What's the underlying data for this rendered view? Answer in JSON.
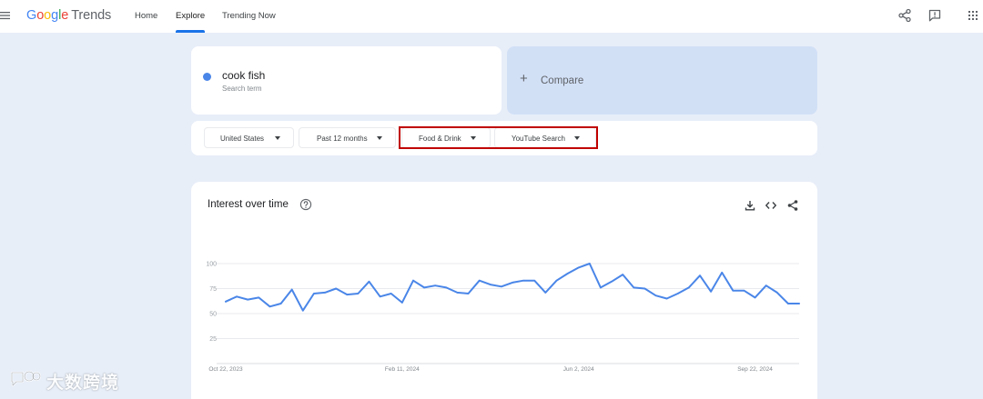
{
  "header": {
    "logo": {
      "google": [
        "G",
        "o",
        "o",
        "g",
        "l",
        "e"
      ],
      "product": "Trends"
    },
    "nav": [
      {
        "label": "Home"
      },
      {
        "label": "Explore"
      },
      {
        "label": "Trending Now"
      }
    ],
    "active_nav": "Explore",
    "icons": [
      "menu-icon",
      "share-icon",
      "feedback-icon",
      "apps-grid-icon"
    ]
  },
  "search": {
    "term": "cook fish",
    "term_subtitle": "Search term",
    "term_color": "#4a86e8",
    "compare_label": "Compare",
    "compare_icon": "plus-icon"
  },
  "filters": {
    "region": "United States",
    "time_range": "Past 12 months",
    "category": "Food & Drink",
    "property": "YouTube Search",
    "highlight_color": "#c00000"
  },
  "chart": {
    "title": "Interest over time",
    "icons": [
      "help-icon",
      "download-icon",
      "embed-icon",
      "share-icon"
    ]
  },
  "chart_data": {
    "type": "line",
    "title": "Interest over time",
    "xlabel": "",
    "ylabel": "",
    "ylim": [
      0,
      100
    ],
    "y_ticks": [
      25,
      50,
      75,
      100
    ],
    "x_tick_labels": [
      "Oct 22, 2023",
      "Feb 11, 2024",
      "Jun 2, 2024",
      "Sep 22, 2024"
    ],
    "x_tick_indices": [
      0,
      16,
      32,
      48
    ],
    "grid": true,
    "series": [
      {
        "color": "#4a86e8",
        "values": [
          62,
          67,
          64,
          66,
          57,
          60,
          74,
          53,
          70,
          71,
          75,
          69,
          70,
          82,
          67,
          70,
          61,
          83,
          76,
          78,
          76,
          71,
          70,
          83,
          79,
          77,
          81,
          83,
          83,
          71,
          83,
          90,
          96,
          100,
          76,
          82,
          89,
          76,
          75,
          68,
          65,
          70,
          76,
          88,
          72,
          91,
          73,
          73,
          66,
          78,
          71,
          60,
          60
        ]
      }
    ]
  },
  "watermark": {
    "text": "大数跨境",
    "icon": "chat-bubble-logo-icon"
  }
}
